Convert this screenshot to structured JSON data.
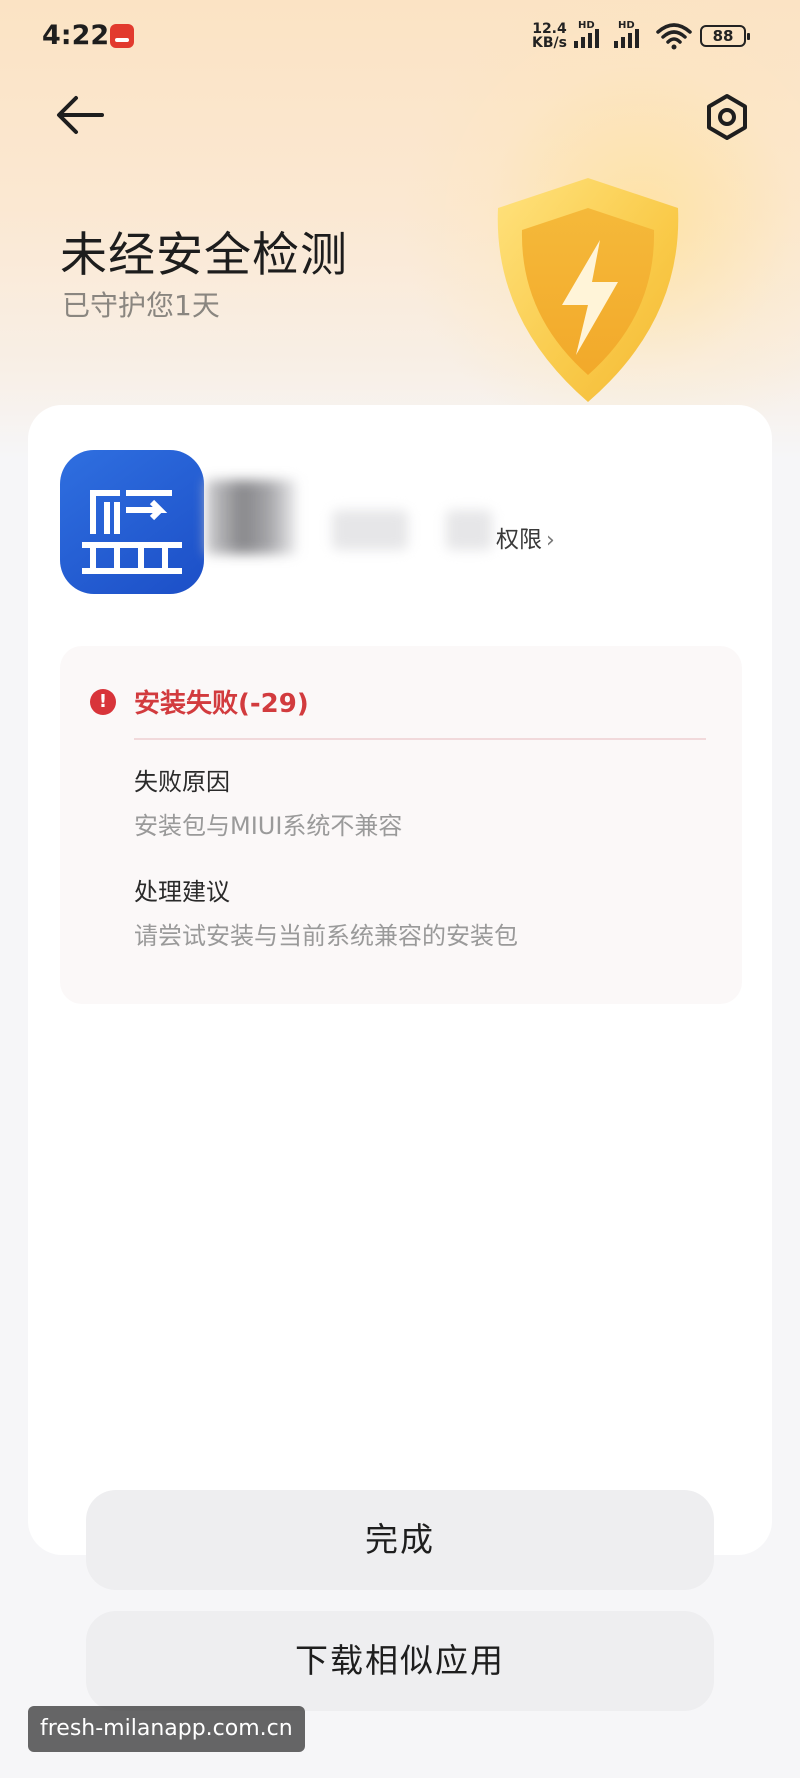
{
  "status_bar": {
    "time": "4:22",
    "net_speed_value": "12.4",
    "net_speed_unit": "KB/s",
    "sim1_label": "HD",
    "sim2_label": "HD",
    "battery": "88",
    "icons": [
      "notification-app-icon",
      "signal-icon",
      "signal-icon",
      "wifi-icon",
      "battery-icon"
    ]
  },
  "header": {
    "back_icon": "arrow-left-icon",
    "settings_icon": "gear-icon",
    "title": "未经安全检测",
    "subtitle": "已守护您1天",
    "shield_icon": "shield-lightning-icon"
  },
  "app": {
    "icon": "app-icon",
    "icon_glyph": "监",
    "permission_link": "权限",
    "permission_chevron": "›"
  },
  "error": {
    "icon": "alert-icon",
    "icon_glyph": "!",
    "title": "安装失败(-29)",
    "reason_label": "失败原因",
    "reason_value": "安装包与MIUI系统不兼容",
    "advice_label": "处理建议",
    "advice_value": "请尝试安装与当前系统兼容的安装包"
  },
  "buttons": {
    "done": "完成",
    "download_similar": "下载相似应用"
  },
  "watermark": "fresh-milanapp.com.cn",
  "colors": {
    "error_red": "#d23b3e",
    "app_icon_blue": "#1c4fc7",
    "button_bg": "#eeeef0",
    "hero_top": "#fbe3c4"
  }
}
